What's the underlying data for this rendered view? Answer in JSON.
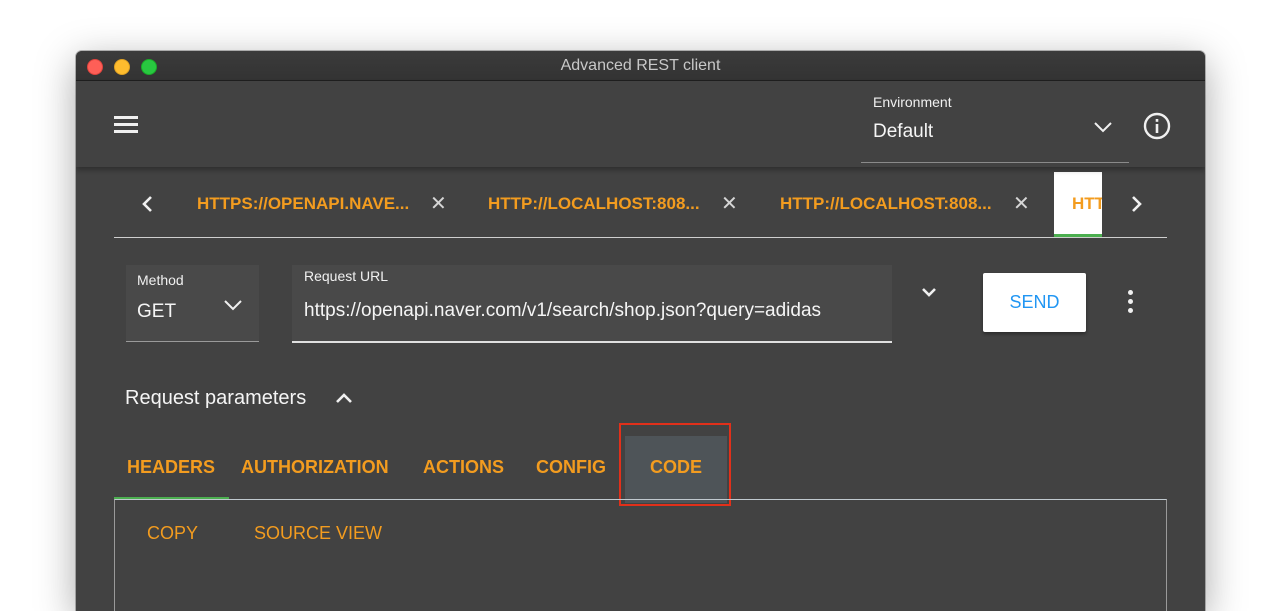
{
  "window": {
    "title": "Advanced REST client"
  },
  "toolbar": {
    "menu_icon": "hamburger-menu-icon",
    "environment": {
      "label": "Environment",
      "value": "Default"
    },
    "info_icon": "info-icon"
  },
  "request_tabs": {
    "items": [
      {
        "label": "HTTPS://OPENAPI.NAVE..."
      },
      {
        "label": "HTTP://LOCALHOST:808..."
      },
      {
        "label": "HTTP://LOCALHOST:808..."
      }
    ],
    "active_tab_label": "HTT"
  },
  "request": {
    "method_label": "Method",
    "method": "GET",
    "url_label": "Request URL",
    "url": "https://openapi.naver.com/v1/search/shop.json?query=adidas",
    "send_label": "SEND"
  },
  "params": {
    "title": "Request parameters",
    "tabs": [
      "HEADERS",
      "AUTHORIZATION",
      "ACTIONS",
      "CONFIG",
      "CODE"
    ],
    "active_tab": "HEADERS",
    "highlighted_tab": "CODE"
  },
  "panel": {
    "actions": [
      "COPY",
      "SOURCE VIEW"
    ]
  },
  "colors": {
    "background": "#424242",
    "accent": "#f39c1f",
    "active_indicator": "#4caf50",
    "send_text": "#2196f3",
    "highlight": "#e1301a"
  }
}
